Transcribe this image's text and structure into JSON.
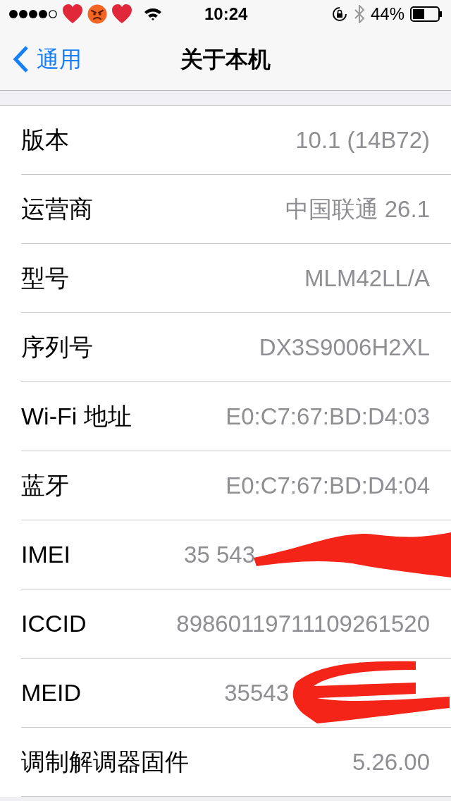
{
  "status_bar": {
    "time": "10:24",
    "battery": "44%"
  },
  "nav": {
    "back": "通用",
    "title": "关于本机"
  },
  "rows": [
    {
      "label": "版本",
      "value": "10.1 (14B72)",
      "redacted": false
    },
    {
      "label": "运营商",
      "value": "中国联通 26.1",
      "redacted": false
    },
    {
      "label": "型号",
      "value": "MLM42LL/A",
      "redacted": false
    },
    {
      "label": "序列号",
      "value": "DX3S9006H2XL",
      "redacted": false
    },
    {
      "label": "Wi-Fi 地址",
      "value": "E0:C7:67:BD:D4:03",
      "redacted": false
    },
    {
      "label": "蓝牙",
      "value": "E0:C7:67:BD:D4:04",
      "redacted": false
    },
    {
      "label": "IMEI",
      "value": "35 543",
      "redacted": true
    },
    {
      "label": "ICCID",
      "value": "89860119711109261520",
      "redacted": false
    },
    {
      "label": "MEID",
      "value": "35543",
      "redacted": true
    },
    {
      "label": "调制解调器固件",
      "value": "5.26.00",
      "redacted": false
    }
  ]
}
